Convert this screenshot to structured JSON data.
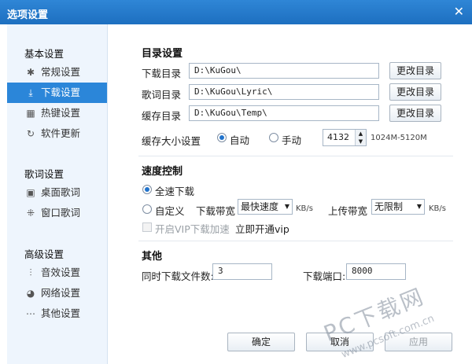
{
  "window": {
    "title": "选项设置",
    "close_glyph": "✕"
  },
  "sidebar": {
    "groups": [
      {
        "title": "基本设置",
        "items": [
          {
            "label": "常规设置",
            "icon": "gear-icon"
          },
          {
            "label": "下载设置",
            "icon": "download-icon"
          },
          {
            "label": "热键设置",
            "icon": "keyboard-icon"
          },
          {
            "label": "软件更新",
            "icon": "update-icon"
          }
        ]
      },
      {
        "title": "歌词设置",
        "items": [
          {
            "label": "桌面歌词",
            "icon": "desktop-lyric-icon"
          },
          {
            "label": "窗口歌词",
            "icon": "window-lyric-icon"
          }
        ]
      },
      {
        "title": "高级设置",
        "items": [
          {
            "label": "音效设置",
            "icon": "equalizer-icon"
          },
          {
            "label": "网络设置",
            "icon": "network-icon"
          },
          {
            "label": "其他设置",
            "icon": "more-icon"
          }
        ]
      }
    ],
    "active": "下载设置"
  },
  "directory": {
    "title": "目录设置",
    "download_label": "下载目录",
    "download_value": "D:\\KuGou\\",
    "lyric_label": "歌词目录",
    "lyric_value": "D:\\KuGou\\Lyric\\",
    "cache_label": "缓存目录",
    "cache_value": "D:\\KuGou\\Temp\\",
    "change_button": "更改目录",
    "cache_size_label": "缓存大小设置",
    "auto_label": "自动",
    "manual_label": "手动",
    "cache_size_value": "4132",
    "cache_range": "1024M-5120M",
    "mode": "auto"
  },
  "speed": {
    "title": "速度控制",
    "full_speed_label": "全速下载",
    "custom_label": "自定义",
    "download_bw_label": "下载带宽",
    "download_bw_value": "最快速度",
    "download_unit": "KB/s",
    "upload_bw_label": "上传带宽",
    "upload_bw_value": "无限制",
    "upload_unit": "KB/s",
    "vip_label": "开启VIP下载加速",
    "vip_link": "立即开通vip",
    "mode": "full"
  },
  "other": {
    "title": "其他",
    "concurrent_label": "同时下载文件数:",
    "concurrent_value": "3",
    "port_label": "下载端口:",
    "port_value": "8000"
  },
  "footer": {
    "ok": "确定",
    "cancel": "取消",
    "apply": "应用"
  },
  "watermark": {
    "brand": "PC下载网",
    "url": "www.pcsoft.com.cn"
  },
  "colors": {
    "titlebar": "#1d6fc0",
    "active_item": "#2b86d9",
    "sidebar_bg": "#eef5fd"
  }
}
